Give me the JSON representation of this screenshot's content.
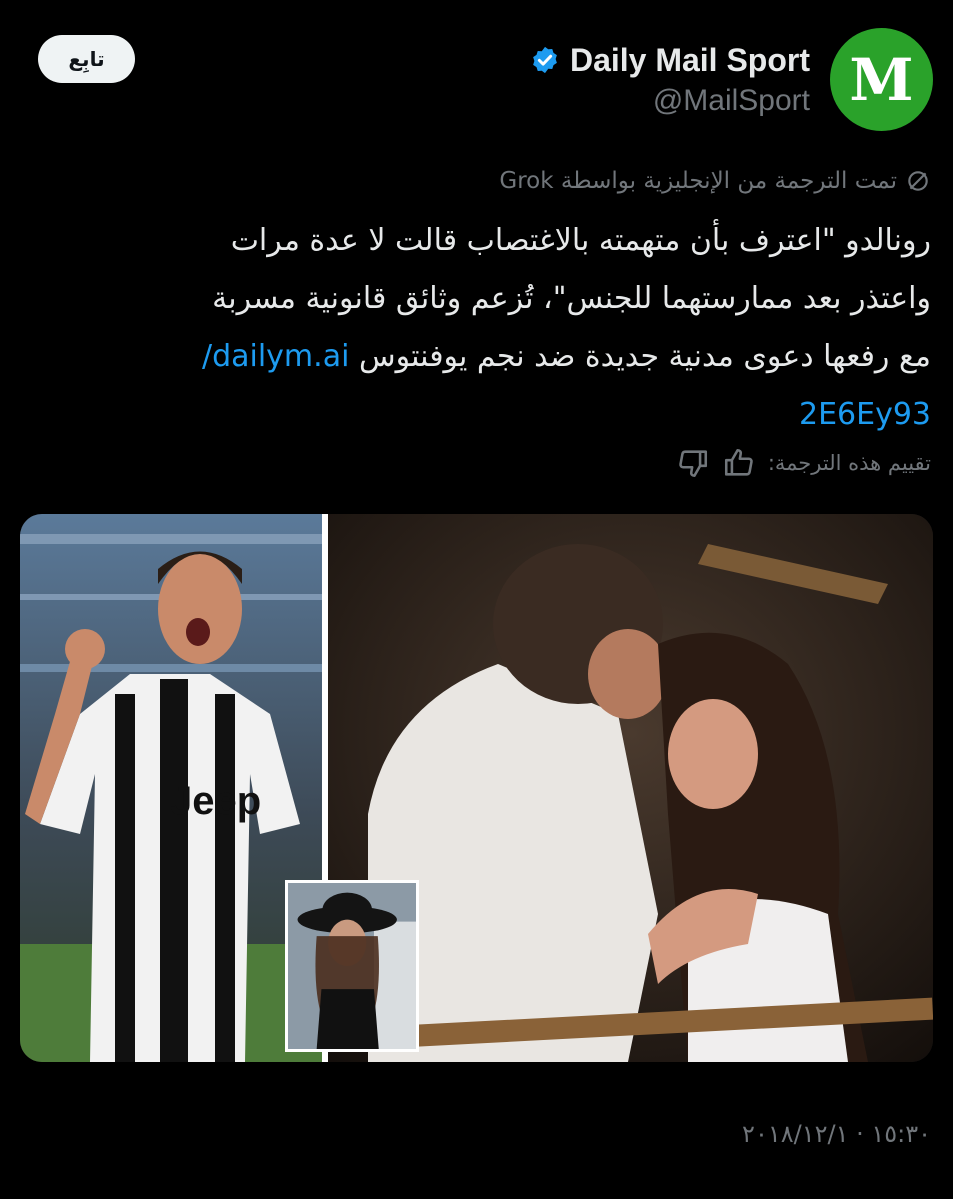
{
  "header": {
    "follow_label": "تابِع",
    "display_name": "Daily Mail Sport",
    "handle": "@MailSport",
    "avatar_letter": "M",
    "avatar_color": "#2aa22a",
    "verified_color": "#1d9bf0"
  },
  "translation": {
    "notice": "تمت الترجمة من الإنجليزية بواسطة Grok",
    "rate_label": "تقييم هذه الترجمة:"
  },
  "tweet": {
    "line1": "رونالدو \"اعترف بأن متهمته بالاغتصاب قالت لا عدة مرات",
    "line2": "واعتذر بعد ممارستهما للجنس\"، تُزعم وثائق قانونية مسربة",
    "line3": "مع رفعها دعوى مدنية جديدة ضد نجم يوفنتوس",
    "link_part1": "dailym.ai/",
    "link_part2": "2E6Ey93"
  },
  "media": {
    "jersey_text": "Jeep",
    "icons": [
      "football-player-photo",
      "couple-photo",
      "woman-hat-inset-photo"
    ]
  },
  "meta": {
    "timestamp": "١٥:٣٠ · ٢٠١٨/١٢/١"
  },
  "colors": {
    "background": "#000000",
    "text": "#e7e9ea",
    "muted": "#71767b",
    "link": "#1d9bf0"
  }
}
